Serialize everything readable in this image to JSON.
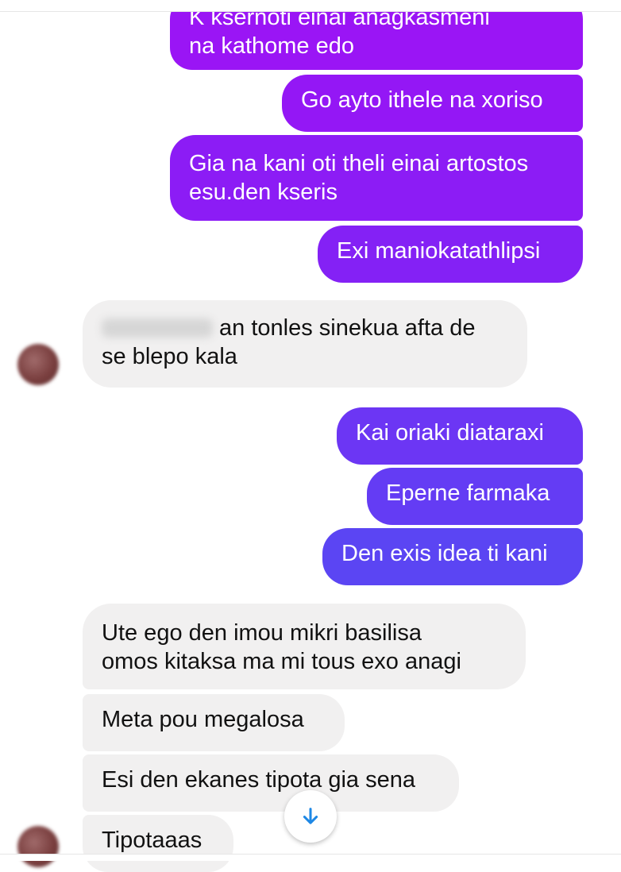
{
  "messages_out": [
    {
      "text_line1": "K ksernoti einai anagkasmeni",
      "text_line2": "na kathome edo"
    },
    {
      "text": "Go ayto ithele na xoriso"
    },
    {
      "text_line1": "Gia na kani oti theli einai artostos",
      "text_line2": "esu.den kseris"
    },
    {
      "text": "Exi maniokatathlipsi"
    },
    {
      "text": "Kai oriaki diataraxi"
    },
    {
      "text": "Eperne farmaka"
    },
    {
      "text": "Den exis idea ti kani"
    }
  ],
  "messages_in": [
    {
      "text_line1_after_name": "an tonles sinekua afta de",
      "text_line2": "se blepo kala"
    },
    {
      "text_line1": "Ute ego den imou mikri basilisa",
      "text_line2": "omos kitaksa ma mi  tous exo anagi"
    },
    {
      "text": "Meta pou megalosa"
    },
    {
      "text": "Esi den ekanes tipota gia sena"
    },
    {
      "text": "Tipotaaas"
    }
  ],
  "colors": {
    "out_top": "#9a15f5",
    "out_mid": "#7a2bf5",
    "out_bottom": "#5b45f3",
    "in_bg": "#f1f0f0",
    "scroll_arrow": "#1e88e5"
  },
  "icons": {
    "scroll_down": "arrow-down-icon"
  }
}
